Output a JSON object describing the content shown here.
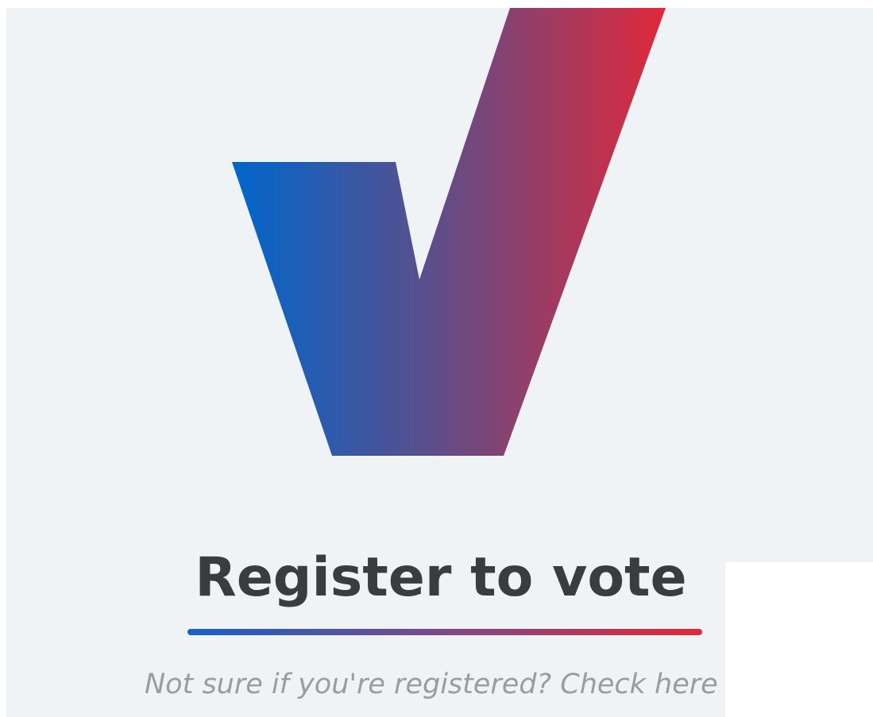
{
  "logo": {
    "icon": "checkmark-icon",
    "gradient_start": "#0066cc",
    "gradient_end": "#e0283a"
  },
  "heading": {
    "title": "Register to vote",
    "underline_start": "#1762c0",
    "underline_end": "#de2a37"
  },
  "link": {
    "text": "Not sure if you're registered? Check here"
  },
  "colors": {
    "background": "#eff3f5",
    "title_text": "#3b3c3d",
    "link_text": "#9a9c9e"
  }
}
